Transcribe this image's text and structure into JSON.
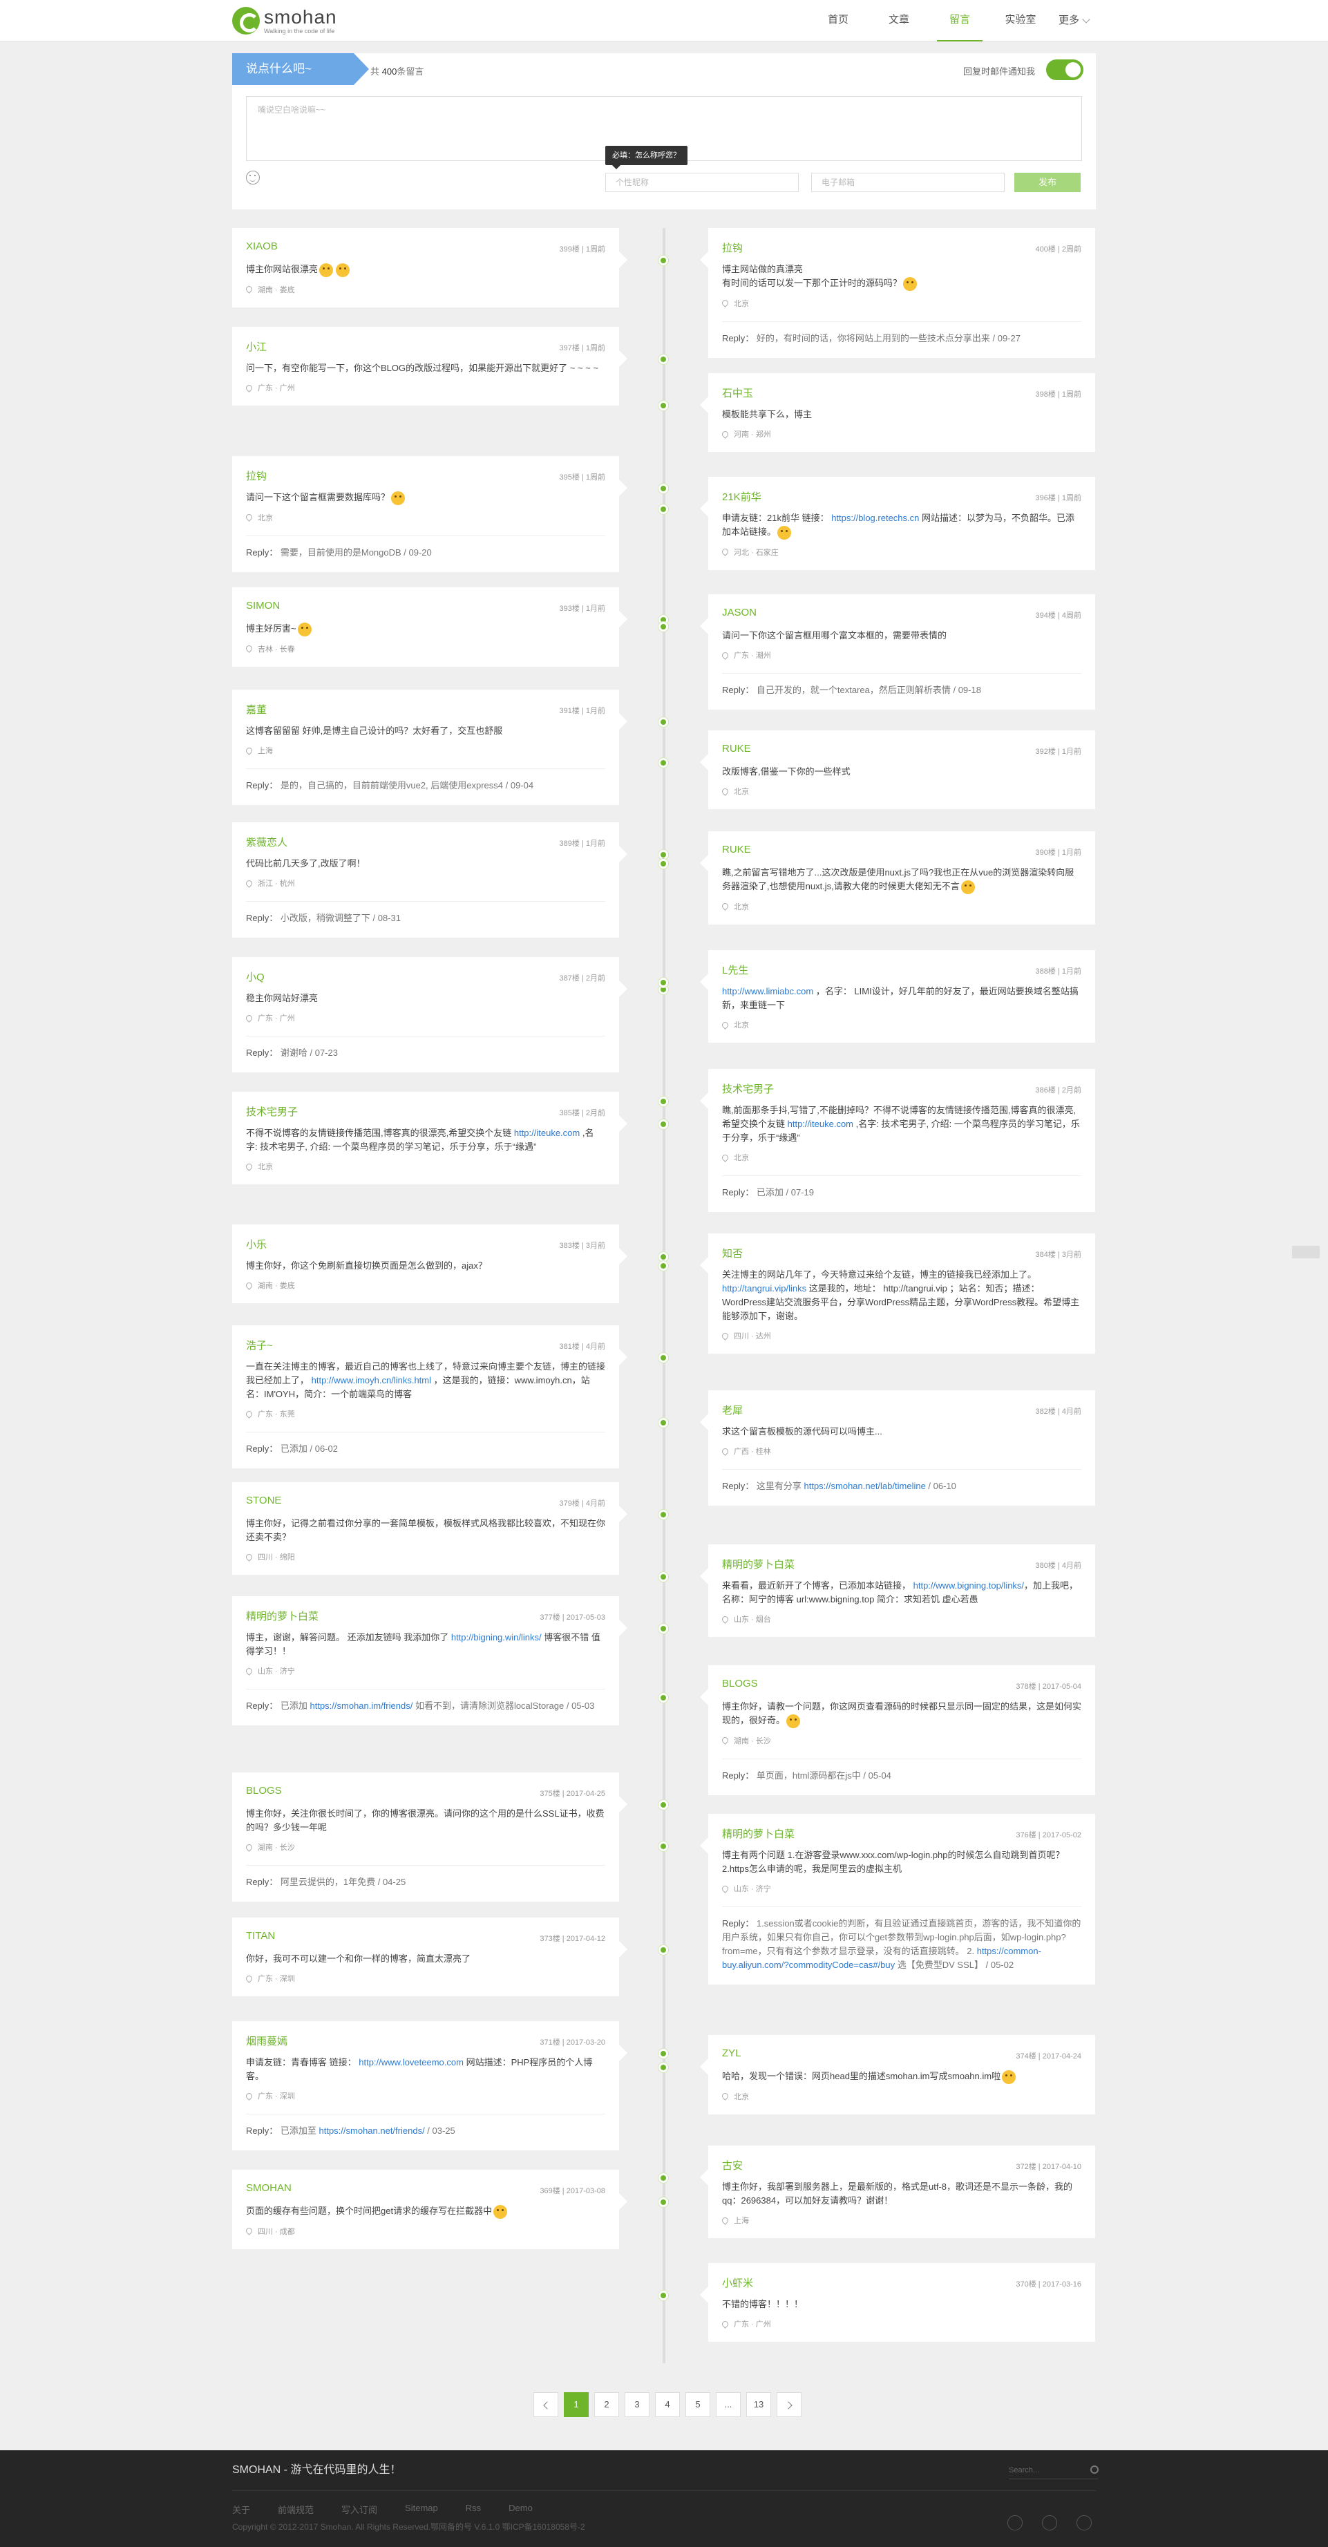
{
  "header": {
    "logo_name": "smohan",
    "logo_tagline": "Walking in the code of life",
    "nav": [
      {
        "label": "首页"
      },
      {
        "label": "文章"
      },
      {
        "label": "留言"
      },
      {
        "label": "实验室"
      },
      {
        "label": "更多"
      }
    ]
  },
  "compose": {
    "ribbon": "说点什么吧~",
    "count_prefix": "共",
    "count": "400",
    "count_suffix": "条留言",
    "notify_label": "回复时邮件通知我",
    "textarea_placeholder": "嘴说空白啥说嘛~~",
    "tooltip": "必填：怎么称呼您？",
    "name_placeholder": "个性昵称",
    "email_placeholder": "电子邮箱",
    "submit": "发布"
  },
  "left": [
    {
      "name": "XIAOB",
      "floor": "399楼",
      "time": "1周前",
      "msg": "博主你网站很漂亮",
      "loc": "湖南 · 娄底",
      "reply": ""
    },
    {
      "name": "小江",
      "floor": "397楼",
      "time": "1周前",
      "msg": "问一下，有空你能写一下，你这个BLOG的改版过程吗，如果能开源出下就更好了 ~ ~ ~ ~",
      "loc": "广东 · 广州",
      "reply": ""
    },
    {
      "name": "拉钩",
      "floor": "395楼",
      "time": "1周前",
      "msg": "请问一下这个留言框需要数据库吗？",
      "loc": "北京",
      "reply": "需要，目前使用的是MongoDB",
      "rdate": "09-20"
    },
    {
      "name": "SIMON",
      "floor": "393楼",
      "time": "1月前",
      "msg": "博主好厉害~",
      "loc": "吉林 · 长春",
      "reply": ""
    },
    {
      "name": "嘉董",
      "floor": "391楼",
      "time": "1月前",
      "msg": "这博客留留留 好帅,是博主自己设计的吗？太好看了，交互也舒服",
      "loc": "上海",
      "reply": "是的，自己搞的，目前前端使用vue2, 后端使用express4",
      "rdate": "09-04"
    },
    {
      "name": "紫薇恋人",
      "floor": "389楼",
      "time": "1月前",
      "msg": "代码比前几天多了,改版了啊！",
      "loc": "浙江 · 杭州",
      "reply": "小改版，稍微调整了下",
      "rdate": "08-31"
    },
    {
      "name": "小Q",
      "floor": "387楼",
      "time": "2月前",
      "msg": "稳主你网站好漂亮",
      "loc": "广东 · 广州",
      "reply": "谢谢哈",
      "rdate": "07-23"
    },
    {
      "name": "技术宅男子",
      "floor": "385楼",
      "time": "2月前",
      "msg": "不得不说博客的友情链接传播范围,博客真的很漂亮,希望交换个友链 ",
      "link": "http://iteuke.com",
      "msg2": " ,名字: 技术宅男子, 介绍: 一个菜鸟程序员的学习笔记，乐于分享，乐于“缘遇”",
      "loc": "北京",
      "reply": ""
    },
    {
      "name": "小乐",
      "floor": "383楼",
      "time": "3月前",
      "msg": "博主你好，你这个免刷新直接切换页面是怎么做到的，ajax？",
      "loc": "湖南 · 娄底",
      "reply": ""
    },
    {
      "name": "浩子~",
      "floor": "381楼",
      "time": "4月前",
      "msg": "一直在关注博主的博客，最近自己的博客也上线了，特意过来向博主要个友链，博主的链接我已经加上了， ",
      "link": "http://www.imoyh.cn/links.html",
      "msg2": " ，这是我的，链接：www.imoyh.cn，站名：IM'OYH，简介：一个前端菜鸟的博客",
      "loc": "广东 · 东莞",
      "reply": "已添加",
      "rdate": "06-02"
    },
    {
      "name": "STONE",
      "floor": "379楼",
      "time": "4月前",
      "msg": "博主你好，记得之前看过你分享的一套简单模板，模板样式风格我都比较喜欢，不知现在你还卖不卖？",
      "loc": "四川 · 绵阳",
      "reply": ""
    },
    {
      "name": "精明的萝卜白菜",
      "floor": "377楼",
      "time": "2017-05-03",
      "msg": "博主，谢谢，解答问题。 还添加友链吗 我添加你了 ",
      "link": "http://bigning.win/links/",
      "msg2": " 博客很不错 值得学习！！",
      "loc": "山东 · 济宁",
      "reply": "已添加 ",
      "rlink": "https://smohan.im/friends/",
      "reply2": " 如看不到，请清除浏览器localStorage",
      "rdate": "05-03"
    },
    {
      "name": "BLOGS",
      "floor": "375楼",
      "time": "2017-04-25",
      "msg": "博主你好，关注你很长时间了，你的博客很漂亮。请问你的这个用的是什么SSL证书，收费的吗？多少钱一年呢",
      "loc": "湖南 · 长沙",
      "reply": "阿里云提供的，1年免费",
      "rdate": "04-25"
    },
    {
      "name": "TITAN",
      "floor": "373楼",
      "time": "2017-04-12",
      "msg": "你好，我可不可以建一个和你一样的博客，简直太漂亮了",
      "loc": "广东 · 深圳",
      "reply": ""
    },
    {
      "name": "烟雨蔓嫣",
      "floor": "371楼",
      "time": "2017-03-20",
      "msg": "申请友链：青春博客 链接： ",
      "link": "http://www.loveteemo.com",
      "msg2": " 网站描述：PHP程序员的个人博客。",
      "loc": "广东 · 深圳",
      "reply": "已添加至 ",
      "rlink": "https://smohan.net/friends/",
      "rdate": "03-25"
    },
    {
      "name": "SMOHAN",
      "floor": "369楼",
      "time": "2017-03-08",
      "msg": "页面的缓存有些问题，换个时间把get请求的缓存写在拦截器中",
      "loc": "四川 · 成都",
      "reply": ""
    }
  ],
  "right": [
    {
      "name": "拉钩",
      "floor": "400楼",
      "time": "2周前",
      "msg": "博主网站做的真漂亮",
      "msg_b": "有时间的话可以发一下那个正计时的源码吗？",
      "loc": "北京",
      "reply": "好的，有时间的话，你将网站上用到的一些技术点分享出来",
      "rdate": "09-27"
    },
    {
      "name": "石中玉",
      "floor": "398楼",
      "time": "1周前",
      "msg": "模板能共享下么，博主",
      "loc": "河南 · 郑州",
      "reply": ""
    },
    {
      "name": "21K前华",
      "floor": "396楼",
      "time": "1周前",
      "msg": "申请友链：21k前华 链接： ",
      "link": "https://blog.retechs.cn",
      "msg2": " 网站描述：以梦为马，不负韶华。已添加本站链接。",
      "loc": "河北 · 石家庄",
      "reply": ""
    },
    {
      "name": "JASON",
      "floor": "394楼",
      "time": "4周前",
      "msg": "请问一下你这个留言框用哪个富文本框的，需要带表情的",
      "loc": "广东 · 潮州",
      "reply": "自己开发的，就一个textarea，然后正则解析表情",
      "rdate": "09-18"
    },
    {
      "name": "RUKE",
      "floor": "392楼",
      "time": "1月前",
      "msg": "改版博客,借鉴一下你的一些样式",
      "loc": "北京",
      "reply": ""
    },
    {
      "name": "RUKE",
      "floor": "390楼",
      "time": "1月前",
      "msg": "瞧,之前留言写错地方了...这次改版是使用nuxt.js了吗?我也正在从vue的浏览器渲染转向服务器渲染了,也想使用nuxt.js,请教大佬的时候更大佬知无不言",
      "loc": "北京",
      "reply": ""
    },
    {
      "name": "L先生",
      "floor": "388楼",
      "time": "1月前",
      "msg": "",
      "link": "http://www.limiabc.com",
      "msg2": " ，名字： LIMI设计，好几年前的好友了，最近网站要换域名整站搞新，来重链一下",
      "loc": "北京",
      "reply": ""
    },
    {
      "name": "技术宅男子",
      "floor": "386楼",
      "time": "2月前",
      "msg": "瞧,前面那条手抖,写错了,不能删掉吗？不得不说博客的友情链接传播范围,博客真的很漂亮,希望交换个友链 ",
      "link": "http://iteuke.com",
      "msg2": " ,名字: 技术宅男子, 介绍: 一个菜鸟程序员的学习笔记，乐于分享，乐于“缘遇”",
      "loc": "北京",
      "reply": "已添加",
      "rdate": "07-19"
    },
    {
      "name": "知否",
      "floor": "384楼",
      "time": "3月前",
      "msg": "关注博主的网站几年了，今天特意过来给个友链，博主的链接我已经添加上了。 ",
      "link": "http://tangrui.vip/links",
      "msg2": " 这是我的，地址： http://tangrui.vip ；站名：知否；描述：WordPress建站交流服务平台，分享WordPress精品主题，分享WordPress教程。希望博主能够添加下，谢谢。",
      "loc": "四川 · 达州",
      "reply": ""
    },
    {
      "name": "老犀",
      "floor": "382楼",
      "time": "4月前",
      "msg": "求这个留言板模板的源代码可以吗博主...",
      "loc": "广西 · 桂林",
      "reply": "这里有分享 ",
      "rlink": "https://smohan.net/lab/timeline",
      "rdate": "06-10"
    },
    {
      "name": "精明的萝卜白菜",
      "floor": "380楼",
      "time": "4月前",
      "msg": "来看看，最近新开了个博客，已添加本站链接， ",
      "link": "http://www.bigning.top/links/",
      "msg2": "，加上我吧，名称：阿宁的博客 url:www.bigning.top 简介：求知若饥 虚心若愚",
      "loc": "山东 · 烟台",
      "reply": ""
    },
    {
      "name": "BLOGS",
      "floor": "378楼",
      "time": "2017-05-04",
      "msg": "博主你好，请教一个问题，你这网页查看源码的时候都只显示同一固定的结果，这是如何实现的，很好奇。",
      "loc": "湖南 · 长沙",
      "reply": "单页面，html源码都在js中",
      "rdate": "05-04"
    },
    {
      "name": "精明的萝卜白菜",
      "floor": "376楼",
      "time": "2017-05-02",
      "msg": "博主有两个问题 1.在游客登录www.xxx.com/wp-login.php的时候怎么自动跳到首页呢？ 2.https怎么申请的呢，我是阿里云的虚拟主机",
      "loc": "山东 · 济宁",
      "reply": "1.session或者cookie的判断，有且验证通过直接跳首页，游客的话，我不知道你的用户系统，如果只有你自己，你可以个get参数带到wp-login.php后面，如wp-login.php?from=me，只有有这个参数才显示登录，没有的话直接跳转。 2. ",
      "rlink": "https://common-buy.aliyun.com/?commodityCode=cas#/buy",
      "reply2": " 选【免费型DV SSL】",
      "rdate": "05-02"
    },
    {
      "name": "ZYL",
      "floor": "374楼",
      "time": "2017-04-24",
      "msg": "哈哈，发现一个错误：网页head里的描述smohan.im写成smoahn.im啦",
      "loc": "北京",
      "reply": ""
    },
    {
      "name": "古安",
      "floor": "372楼",
      "time": "2017-04-10",
      "msg": "博主你好，我部署到服务器上，是最新版的，格式是utf-8，歌词还是不显示一条龄，我的qq：2696384，可以加好友请教吗？谢谢！",
      "loc": "上海",
      "reply": ""
    },
    {
      "name": "小虾米",
      "floor": "370楼",
      "time": "2017-03-16",
      "msg": "不错的博客！！！！",
      "loc": "广东 · 广州",
      "reply": ""
    }
  ],
  "pagination": {
    "pages": [
      "1",
      "2",
      "3",
      "4",
      "5",
      "...",
      "13"
    ],
    "current": "1"
  },
  "footer": {
    "title": "SMOHAN - 游弋在代码里的人生！",
    "search_placeholder": "Search...",
    "links": [
      "关于",
      "前端规范",
      "写入订阅",
      "Sitemap",
      "Rss",
      "Demo"
    ],
    "copyright": "Copyright © 2012-2017 Smohan. All Rights Reserved.鄂网备的号 V.6.1.0 鄂ICP备16018058号-2"
  },
  "colors": {
    "accent": "#6fb52c",
    "link": "#2d7bd0",
    "ribbon": "#6da8e6",
    "footer": "#262626"
  }
}
